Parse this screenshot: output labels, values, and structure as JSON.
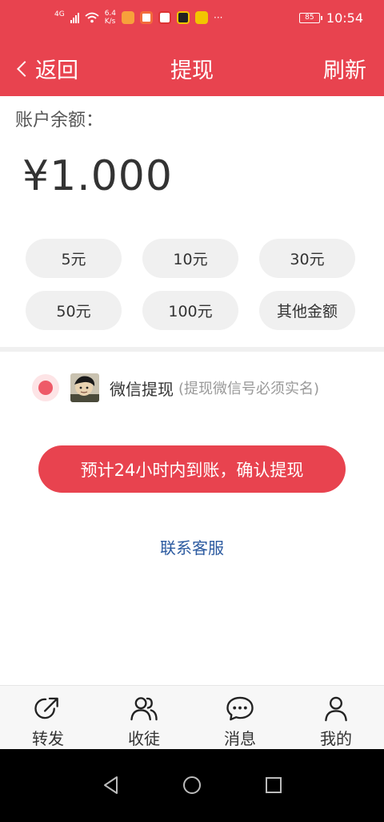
{
  "status_bar": {
    "network": "4G",
    "speed_value": "6.4",
    "speed_unit": "K/s",
    "more": "···",
    "battery": "85",
    "time": "10:54"
  },
  "nav": {
    "back_label": "返回",
    "title": "提现",
    "refresh_label": "刷新"
  },
  "account": {
    "balance_label": "账户余额：",
    "balance_value": "¥1.000"
  },
  "amount_options": [
    "5元",
    "10元",
    "30元",
    "50元",
    "100元",
    "其他金额"
  ],
  "withdraw_method": {
    "label": "微信提现",
    "hint": "(提现微信号必须实名)"
  },
  "confirm_button": "预计24小时内到账，确认提现",
  "service_link": "联系客服",
  "tabs": [
    {
      "label": "转发",
      "icon": "share-icon"
    },
    {
      "label": "收徒",
      "icon": "users-icon"
    },
    {
      "label": "消息",
      "icon": "message-icon"
    },
    {
      "label": "我的",
      "icon": "user-icon"
    }
  ],
  "colors": {
    "brand": "#e8434f",
    "link": "#2b5aa0"
  }
}
